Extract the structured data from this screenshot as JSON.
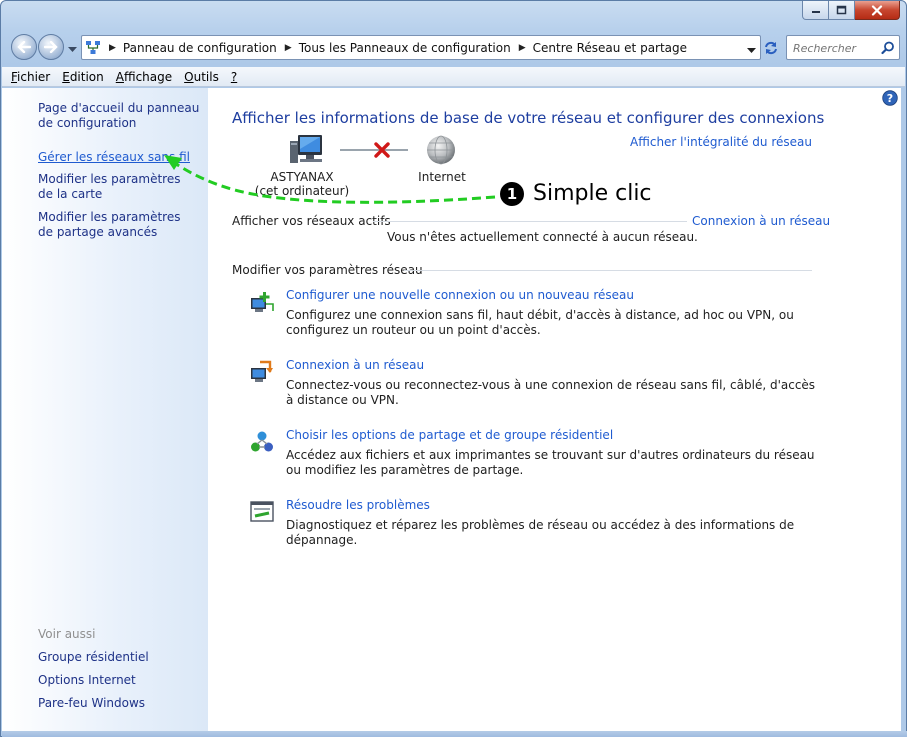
{
  "breadcrumbs": [
    "Panneau de configuration",
    "Tous les Panneaux de configuration",
    "Centre Réseau et partage"
  ],
  "search": {
    "placeholder": "Rechercher"
  },
  "menu": [
    {
      "label": "Fichier",
      "accel": "F",
      "rest": "ichier"
    },
    {
      "label": "Edition",
      "accel": "E",
      "rest": "dition"
    },
    {
      "label": "Affichage",
      "accel": "A",
      "rest": "ffichage"
    },
    {
      "label": "Outils",
      "accel": "O",
      "rest": "utils"
    },
    {
      "label": "?",
      "accel": "?",
      "rest": ""
    }
  ],
  "left_pane": {
    "home_link": "Page d'accueil du panneau de configuration",
    "manage_wireless": "Gérer les réseaux sans fil",
    "adapter_settings": "Modifier les paramètres de la carte",
    "sharing_settings": "Modifier les paramètres de partage avancés",
    "see_also_title": "Voir aussi",
    "see_also": [
      "Groupe résidentiel",
      "Options Internet",
      "Pare-feu Windows"
    ]
  },
  "main": {
    "title": "Afficher les informations de base de votre réseau et configurer des connexions",
    "full_map_link": "Afficher l'intégralité du réseau",
    "computer_name": "ASTYANAX",
    "computer_sub": "(cet ordinateur)",
    "internet_label": "Internet",
    "active_networks_heading": "Afficher vos réseaux actifs",
    "connect_link": "Connexion à un réseau",
    "not_connected": "Vous n'êtes actuellement connecté à aucun réseau.",
    "change_settings_heading": "Modifier vos paramètres réseau",
    "tasks": [
      {
        "title": "Configurer une nouvelle connexion ou un nouveau réseau",
        "desc": "Configurez une connexion sans fil, haut débit, d'accès à distance, ad hoc ou VPN, ou configurez un routeur ou un point d'accès.",
        "icon": "new-connection-icon"
      },
      {
        "title": "Connexion à un réseau",
        "desc": "Connectez-vous ou reconnectez-vous à une connexion de réseau sans fil, câblé, d'accès à distance ou VPN.",
        "icon": "connect-network-icon"
      },
      {
        "title": "Choisir les options de partage et de groupe résidentiel",
        "desc": "Accédez aux fichiers et aux imprimantes se trouvant sur d'autres ordinateurs du réseau ou modifiez les paramètres de partage.",
        "icon": "homegroup-icon"
      },
      {
        "title": "Résoudre les problèmes",
        "desc": "Diagnostiquez et réparez les problèmes de réseau ou accédez à des informations de dépannage.",
        "icon": "troubleshoot-icon"
      }
    ]
  },
  "annotation": {
    "number": "1",
    "text": "Simple clic"
  },
  "colors": {
    "link": "#1f5bd0",
    "title": "#1e3ea0",
    "nav_link": "#1e3287",
    "arrow": "#22cc22"
  }
}
